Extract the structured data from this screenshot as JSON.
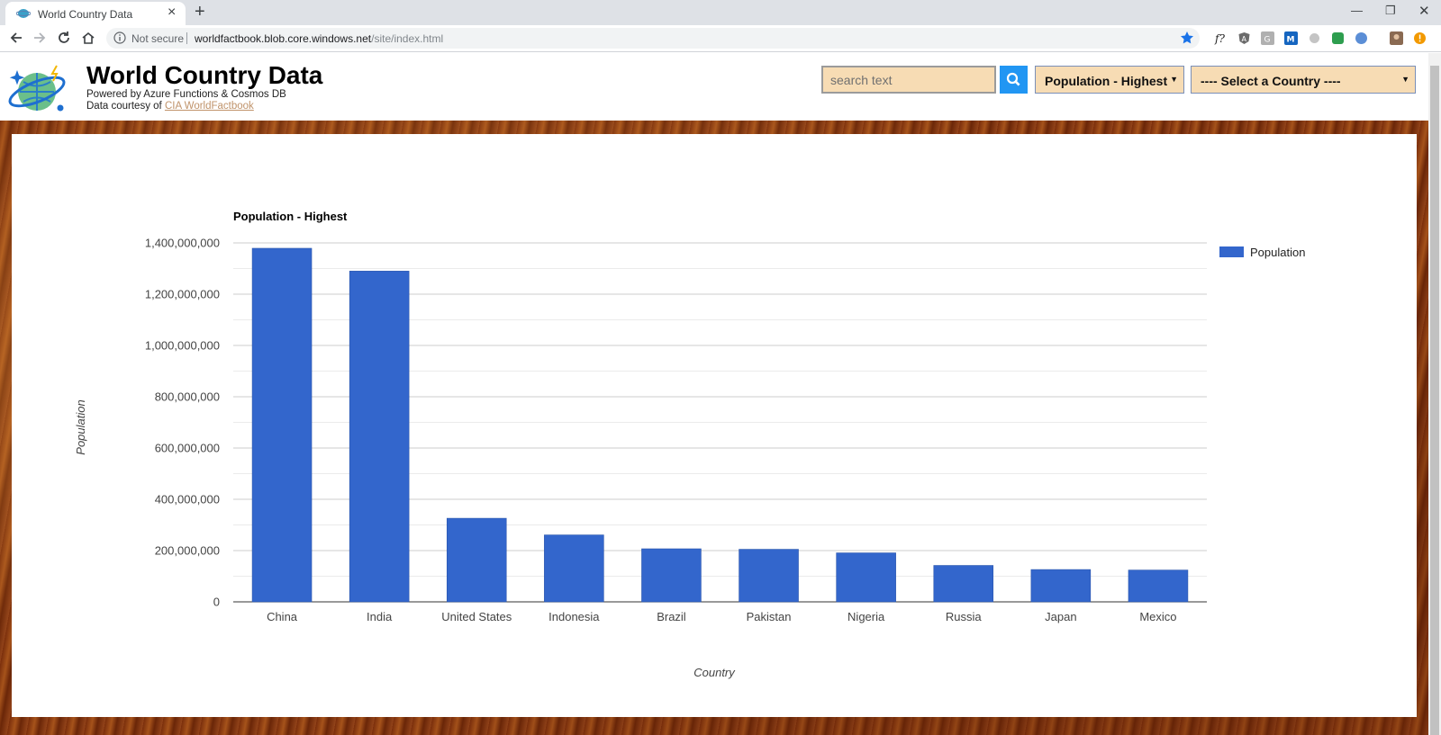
{
  "browser": {
    "tab_title": "World Country Data",
    "security_label": "Not secure",
    "url_host": "worldfactbook.blob.core.windows.net",
    "url_path": "/site/index.html"
  },
  "header": {
    "title": "World Country Data",
    "subtitle": "Powered by Azure Functions & Cosmos DB",
    "courtesy_prefix": "Data courtesy of",
    "courtesy_link": "CIA WorldFactbook"
  },
  "controls": {
    "search_placeholder": "search text",
    "sort_selected": "Population - Highest",
    "country_selected": "---- Select a Country ----"
  },
  "chart_data": {
    "type": "bar",
    "title": "Population - Highest",
    "xlabel": "Country",
    "ylabel": "Population",
    "categories": [
      "China",
      "India",
      "United States",
      "Indonesia",
      "Brazil",
      "Pakistan",
      "Nigeria",
      "Russia",
      "Japan",
      "Mexico"
    ],
    "series": [
      {
        "name": "Population",
        "color": "#3366cc",
        "values": [
          1379000000,
          1290000000,
          326000000,
          261000000,
          207000000,
          205000000,
          191000000,
          142000000,
          126000000,
          124000000
        ]
      }
    ],
    "ylim": [
      0,
      1400000000
    ],
    "yticks": [
      0,
      200000000,
      400000000,
      600000000,
      800000000,
      1000000000,
      1200000000,
      1400000000
    ],
    "ytick_labels": [
      "0",
      "200,000,000",
      "400,000,000",
      "600,000,000",
      "800,000,000",
      "1,000,000,000",
      "1,200,000,000",
      "1,400,000,000"
    ],
    "grid": true,
    "legend": "right"
  }
}
